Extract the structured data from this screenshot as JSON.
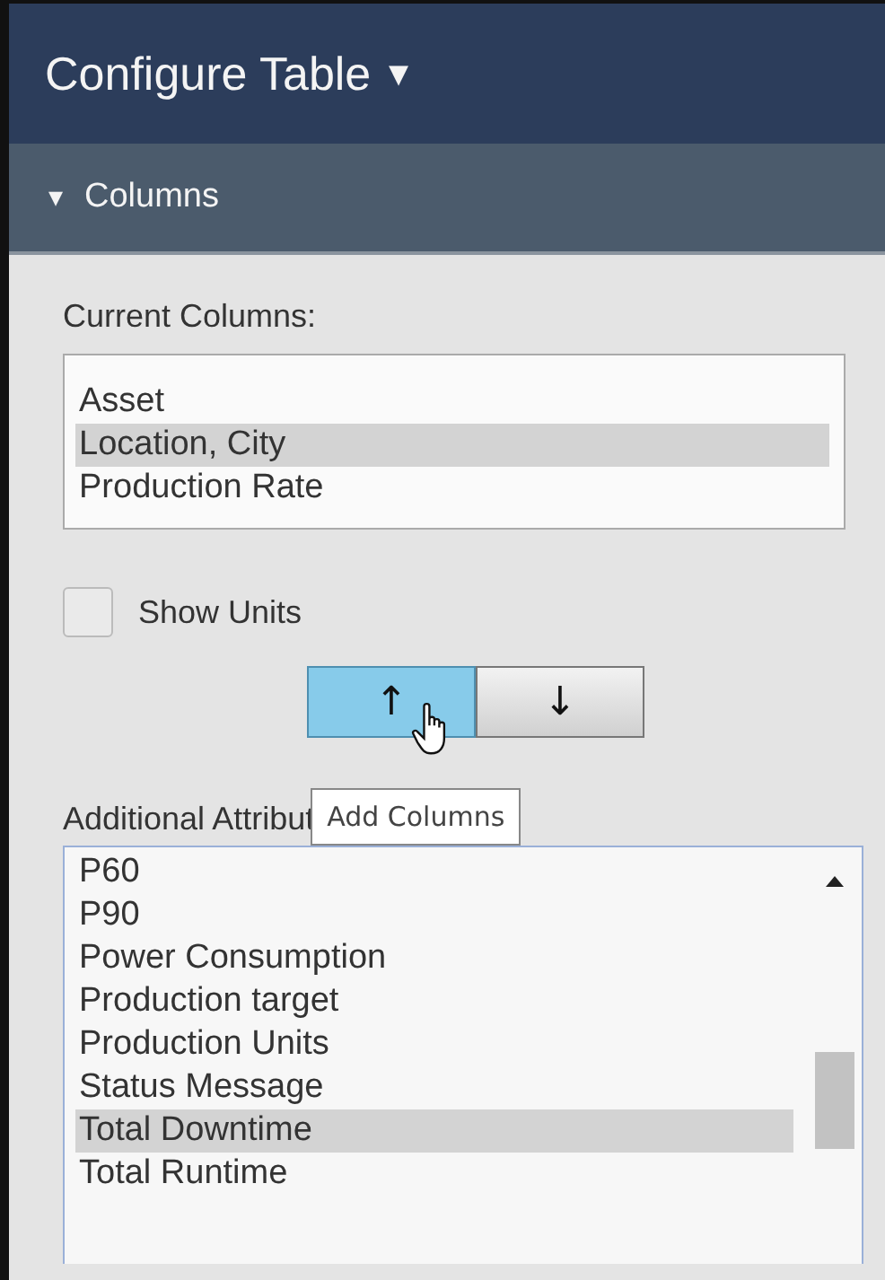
{
  "header": {
    "title": "Configure Table",
    "caret": "▾"
  },
  "section": {
    "title": "Columns",
    "expanded": true,
    "caret": "▾"
  },
  "current_columns": {
    "label": "Current Columns:",
    "items": [
      {
        "label": "Asset",
        "selected": false
      },
      {
        "label": "Location, City",
        "selected": true
      },
      {
        "label": "Production Rate",
        "selected": false
      }
    ]
  },
  "show_units": {
    "label": "Show Units",
    "checked": false
  },
  "move_buttons": [
    {
      "label": "↑",
      "hovered": true
    },
    {
      "label": "↓",
      "hovered": false
    }
  ],
  "additional_attributes": {
    "label": "Additional Attribut",
    "items": [
      {
        "label": "P60",
        "selected": false
      },
      {
        "label": "P90",
        "selected": false
      },
      {
        "label": "Power Consumption",
        "selected": false
      },
      {
        "label": "Production target",
        "selected": false
      },
      {
        "label": "Production Units",
        "selected": false
      },
      {
        "label": "Status Message",
        "selected": false
      },
      {
        "label": "Total Downtime",
        "selected": true
      },
      {
        "label": "Total Runtime",
        "selected": false
      }
    ]
  },
  "tooltip": {
    "text": "Add Columns"
  }
}
